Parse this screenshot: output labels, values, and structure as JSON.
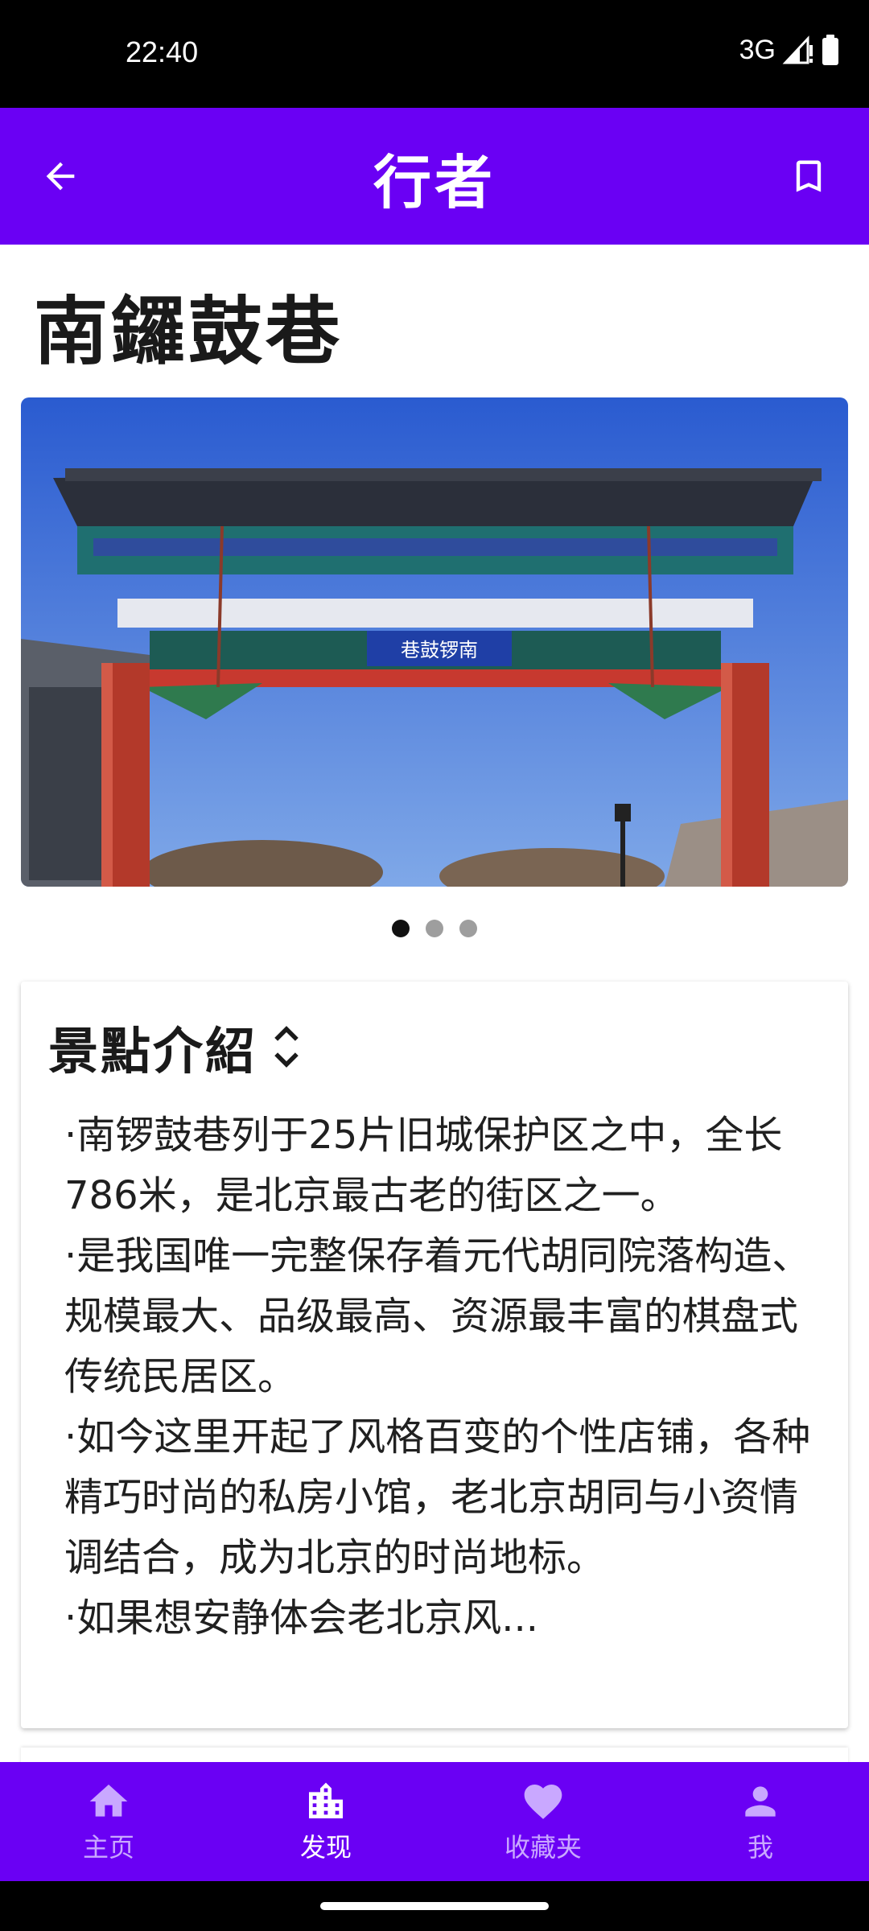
{
  "status_bar": {
    "time": "22:40",
    "network": "3G",
    "icons": [
      "signal-icon",
      "battery-icon"
    ]
  },
  "app_bar": {
    "title": "行者",
    "back_icon": "arrow-back-icon",
    "bookmark_icon": "bookmark-icon"
  },
  "place": {
    "title": "南鑼鼓巷",
    "image_sign_text": "巷鼓锣南",
    "carousel": {
      "pages": 3,
      "active_index": 0
    }
  },
  "intro": {
    "title": "景點介紹",
    "expand_icon": "unfold-icon",
    "paragraphs": [
      "·南锣鼓巷列于25片旧城保护区之中，全长786米，是北京最古老的街区之一。",
      "·是我国唯一完整保存着元代胡同院落构造、规模最大、品级最高、资源最丰富的棋盘式传统民居区。",
      "·如今这里开起了风格百变的个性店铺，各种精巧时尚的私房小馆，老北京胡同与小资情调结合，成为北京的时尚地标。",
      "·如果想安静体会老北京风..."
    ]
  },
  "bottom_nav": {
    "items": [
      {
        "label": "主页",
        "icon": "home-icon",
        "active": false
      },
      {
        "label": "发现",
        "icon": "city-icon",
        "active": true
      },
      {
        "label": "收藏夹",
        "icon": "heart-icon",
        "active": false
      },
      {
        "label": "我",
        "icon": "person-icon",
        "active": false
      }
    ]
  },
  "colors": {
    "primary": "#6a00f4",
    "nav_inactive": "#c9a8ff",
    "nav_active": "#ffffff"
  }
}
